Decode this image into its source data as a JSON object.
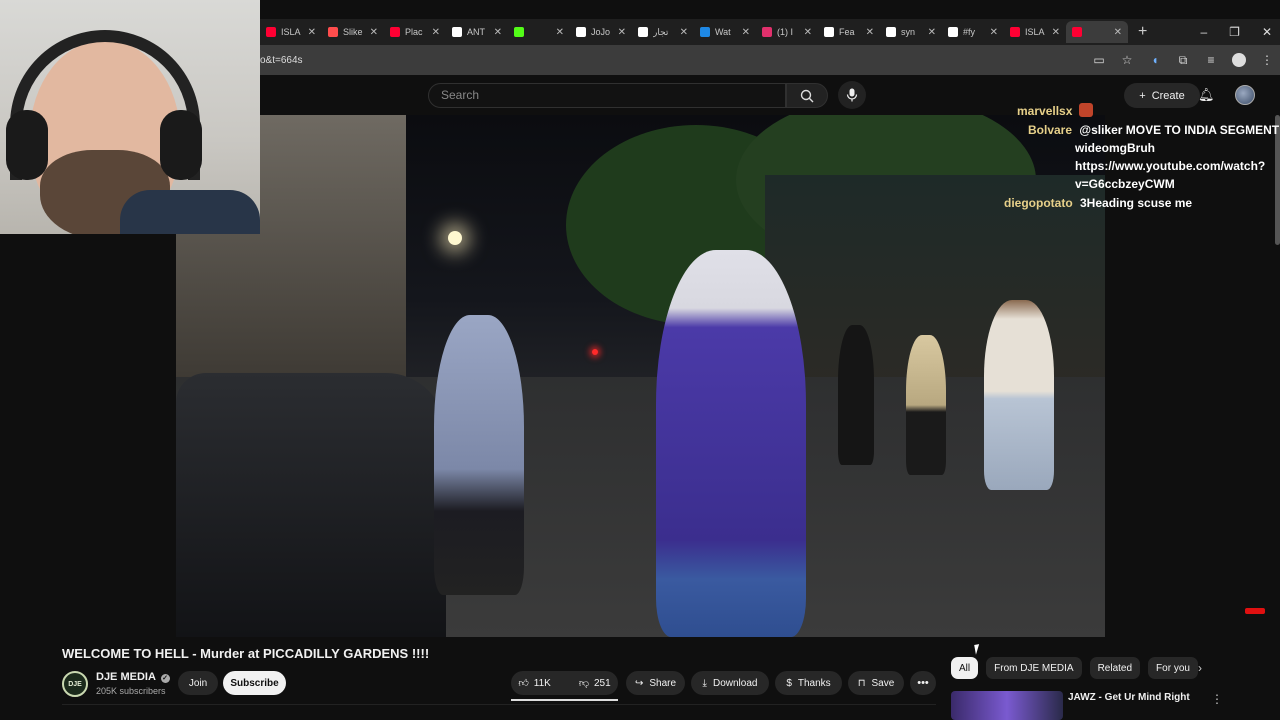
{
  "browser": {
    "tabs": [
      {
        "label": "ISLA",
        "color": "#ff0033"
      },
      {
        "label": "Slike",
        "color": "#ff4d4d"
      },
      {
        "label": "Plac",
        "color": "#ff0033"
      },
      {
        "label": "ANT",
        "color": "#ffffff"
      },
      {
        "label": "",
        "color": "#53fc18"
      },
      {
        "label": "JoJo",
        "color": "#ffffff"
      },
      {
        "label": "تجار",
        "color": "#ffffff"
      },
      {
        "label": "Wat",
        "color": "#1e88e5"
      },
      {
        "label": "(1) I",
        "color": "#e1306c"
      },
      {
        "label": "Fea",
        "color": "#ffffff"
      },
      {
        "label": "syn",
        "color": "#ffffff"
      },
      {
        "label": "#fy",
        "color": "#ffffff"
      },
      {
        "label": "ISLA",
        "color": "#ff0033"
      },
      {
        "label": "",
        "color": "#ff0033"
      }
    ],
    "url": "o&t=664s"
  },
  "youtube": {
    "search_placeholder": "Search",
    "create_label": "Create"
  },
  "chat": [
    {
      "user": "marvellsx",
      "text": ""
    },
    {
      "user": "Bolvare",
      "text": "@sliker MOVE TO INDIA SEGMENT BR"
    },
    {
      "user": "",
      "text": "wideomgBruh"
    },
    {
      "user": "",
      "text": "https://www.youtube.com/watch?"
    },
    {
      "user": "",
      "text": "v=G6ccbzeyCWM"
    },
    {
      "user": "diegopotato",
      "text": "3Heading scuse me"
    }
  ],
  "video_info": {
    "title": "WELCOME TO HELL - Murder at PICCADILLY GARDENS !!!!",
    "channel": "DJE MEDIA",
    "channel_logo": "DJE",
    "subscribers": "205K subscribers",
    "join_label": "Join",
    "subscribe_label": "Subscribe",
    "likes": "11K",
    "dislikes": "251",
    "share_label": "Share",
    "download_label": "Download",
    "thanks_label": "Thanks",
    "save_label": "Save"
  },
  "chips": [
    "All",
    "From DJE MEDIA",
    "Related",
    "For you"
  ],
  "related": [
    {
      "title": "JAWZ - Get Ur Mind Right"
    }
  ]
}
